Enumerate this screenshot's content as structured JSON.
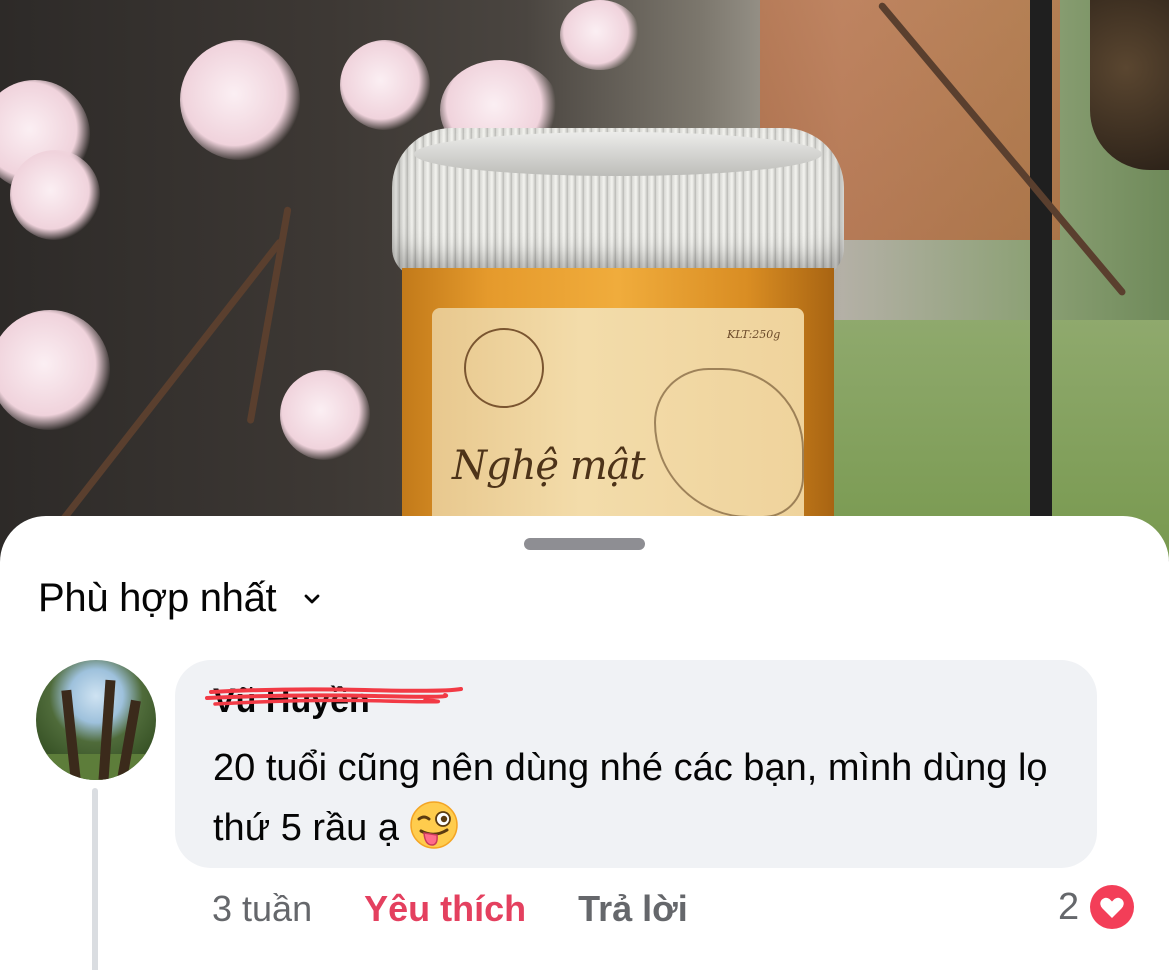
{
  "jar_label": {
    "brand_text": "Nghệ mật",
    "net_weight": "KLT:250g"
  },
  "sheet": {
    "sort_label": "Phù hợp nhất",
    "comment": {
      "author": "Vũ Huyền",
      "text": "20 tuổi cũng nên dùng nhé các bạn, mình dùng lọ thứ 5 rầu ạ",
      "emoji": "winking-face-with-tongue",
      "time": "3 tuần",
      "like_label": "Yêu thích",
      "reply_label": "Trả lời",
      "reaction_count": "2",
      "reaction_type": "love",
      "like_color": "#e4405f",
      "reaction_color": "#f33e58"
    }
  }
}
